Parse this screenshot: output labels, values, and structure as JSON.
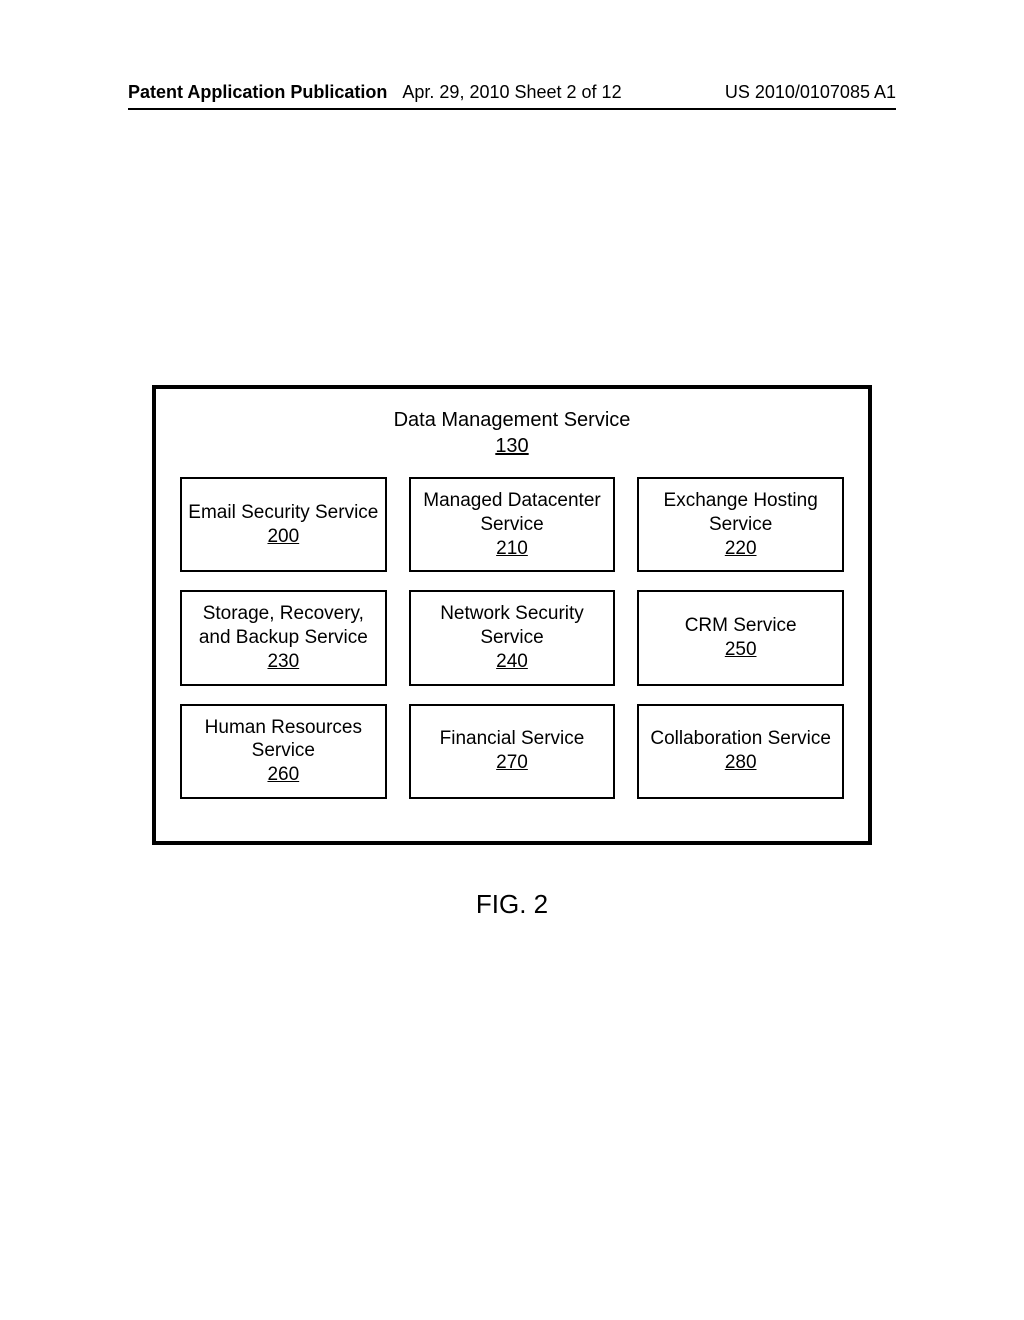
{
  "header": {
    "left": "Patent Application Publication",
    "center": "Apr. 29, 2010  Sheet 2 of 12",
    "right": "US 2010/0107085 A1"
  },
  "diagram": {
    "title": "Data Management Service",
    "title_ref": "130",
    "services": [
      {
        "label": "Email Security Service",
        "ref": "200"
      },
      {
        "label": "Managed Datacenter Service",
        "ref": "210"
      },
      {
        "label": "Exchange Hosting Service",
        "ref": "220"
      },
      {
        "label": "Storage, Recovery, and Backup Service",
        "ref": "230"
      },
      {
        "label": "Network Security Service",
        "ref": "240"
      },
      {
        "label": "CRM Service",
        "ref": "250"
      },
      {
        "label": "Human Resources Service",
        "ref": "260"
      },
      {
        "label": "Financial Service",
        "ref": "270"
      },
      {
        "label": "Collaboration Service",
        "ref": "280"
      }
    ],
    "caption": "FIG. 2"
  }
}
